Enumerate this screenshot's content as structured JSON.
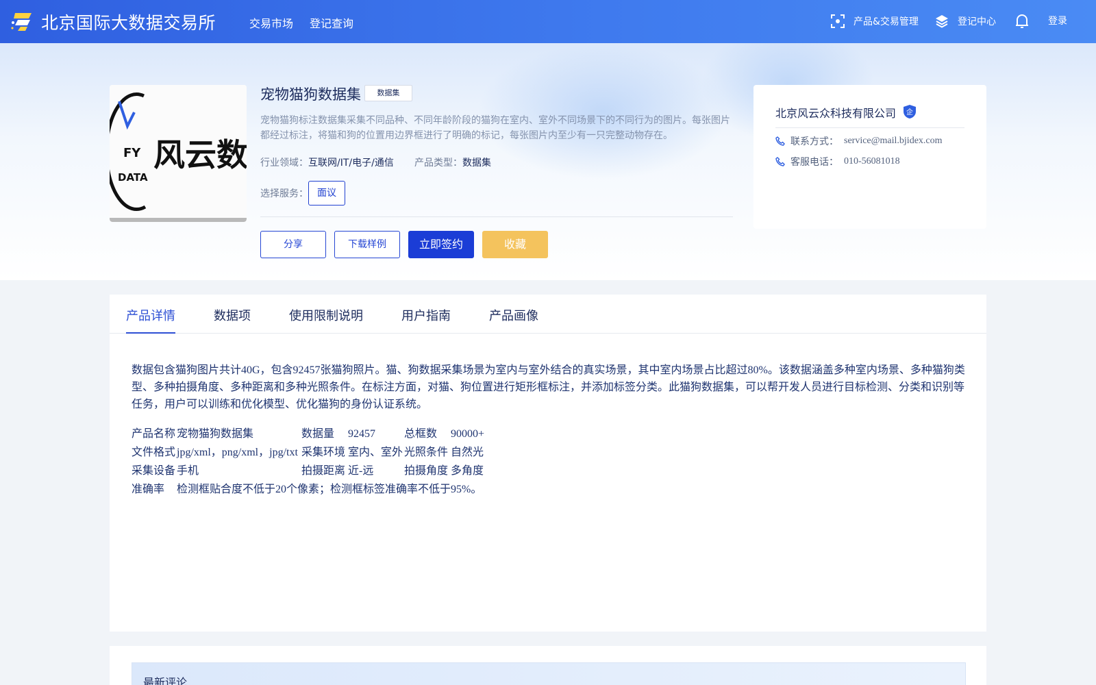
{
  "header": {
    "brand": "北京国际大数据交易所",
    "nav": [
      "交易市场",
      "登记查询"
    ],
    "product_mgmt": "产品&交易管理",
    "registry_center": "登记中心",
    "login": "登录"
  },
  "product": {
    "image_text": "风云数据",
    "image_sub": "FY DATA",
    "title": "宠物猫狗数据集",
    "type_tag": "数据集",
    "description": "宠物猫狗标注数据集采集不同品种、不同年龄阶段的猫狗在室内、室外不同场景下的不同行为的图片。每张图片都经过标注，将猫和狗的位置用边界框进行了明确的标记，每张图片内至少有一只完整动物存在。",
    "industry_label": "行业领域：",
    "industry_value": "互联网/IT/电子/通信",
    "product_type_label": "产品类型：",
    "product_type_value": "数据集",
    "service_label": "选择服务：",
    "service_option": "面议",
    "buttons": {
      "share": "分享",
      "download_sample": "下载样例",
      "sign_now": "立即签约",
      "favorite": "收藏"
    }
  },
  "company": {
    "name": "北京风云众科技有限公司",
    "badge": "企",
    "contact_label": "联系方式：",
    "contact_value": "service@mail.bjidex.com",
    "phone_label": "客服电话：",
    "phone_value": "010-56081018"
  },
  "tabs": [
    "产品详情",
    "数据项",
    "使用限制说明",
    "用户指南",
    "产品画像"
  ],
  "active_tab": 0,
  "detail": {
    "text": "数据包含猫狗图片共计40G，包含92457张猫狗照片。猫、狗数据采集场景为室内与室外结合的真实场景，其中室内场景占比超过80%。该数据涵盖多种室内场景、多种猫狗类型、多种拍摄角度、多种距离和多种光照条件。在标注方面，对猫、狗位置进行矩形框标注，并添加标签分类。此猫狗数据集，可以帮开发人员进行目标检测、分类和识别等任务，用户可以训练和优化模型、优化猫狗的身份认证系统。",
    "spec": {
      "r1": [
        "产品名称",
        "宠物猫狗数据集",
        "数据量",
        "92457",
        "总框数",
        "90000+"
      ],
      "r2": [
        "文件格式",
        "jpg/xml，png/xml，jpg/txt",
        "采集环境",
        "室内、室外",
        "光照条件",
        "自然光"
      ],
      "r3": [
        "采集设备",
        "手机",
        "拍摄距离",
        "近-远",
        "拍摄角度",
        "多角度"
      ],
      "r4": [
        "准确率",
        "检测框贴合度不低于20个像素；检测框标签准确率不低于95%。"
      ]
    }
  },
  "comments": {
    "title": "最新评论"
  }
}
